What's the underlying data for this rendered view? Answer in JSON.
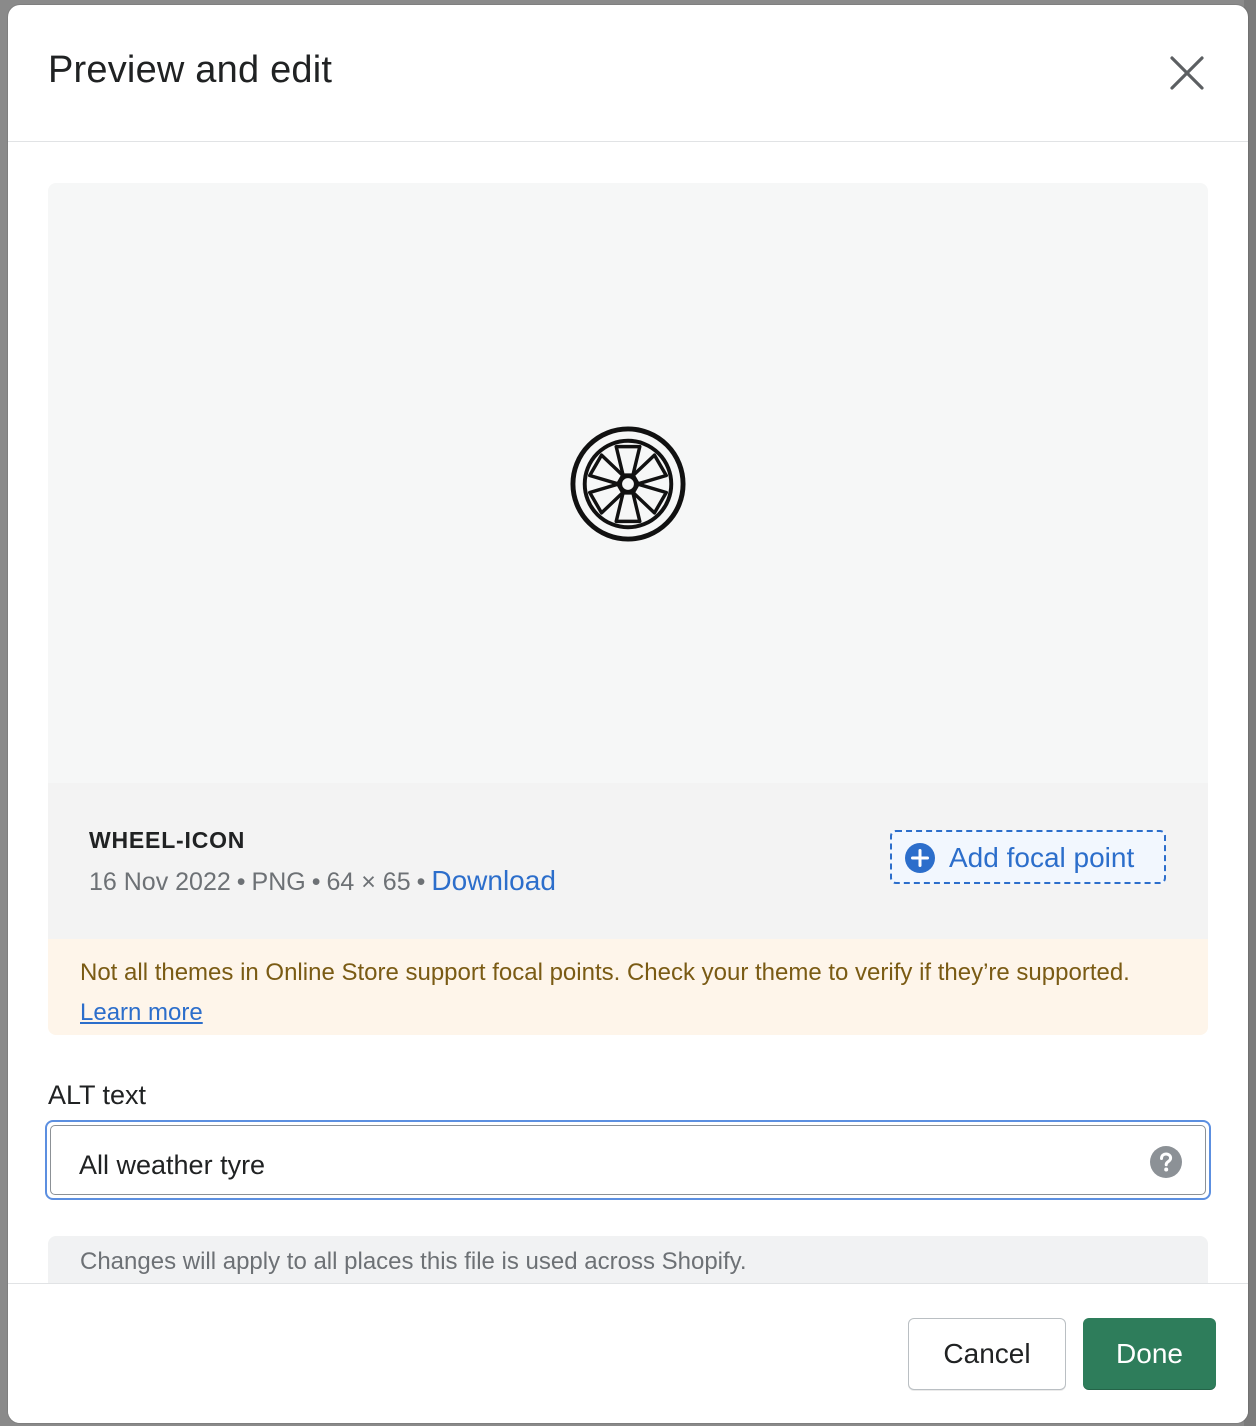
{
  "modal": {
    "title": "Preview and edit",
    "close_icon": "close-icon"
  },
  "preview": {
    "image_icon": "wheel-icon"
  },
  "file": {
    "name": "WHEEL-ICON",
    "date": "16 Nov 2022",
    "type": "PNG",
    "dimensions": "64 × 65",
    "separator": "•",
    "download_label": "Download",
    "focal_button_label": "Add focal point",
    "focal_icon": "plus-circle-icon"
  },
  "warning": {
    "text": "Not all themes in Online Store support focal points. Check your theme to verify if they’re supported.",
    "link_label": "Learn more"
  },
  "alt_text": {
    "label": "ALT text",
    "value": "All weather tyre",
    "help_icon": "question-circle-icon"
  },
  "note": {
    "text": "Changes will apply to all places this file is used across Shopify."
  },
  "footer": {
    "cancel_label": "Cancel",
    "done_label": "Done"
  },
  "colors": {
    "primary": "#2e7d5b",
    "link": "#2c6ecb",
    "warning_bg": "#fef5ea",
    "warning_text": "#7a5b14"
  }
}
